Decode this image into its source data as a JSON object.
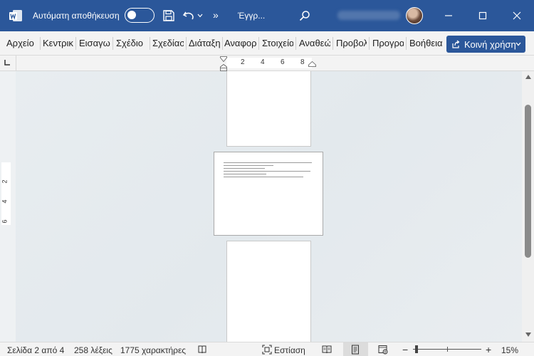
{
  "titlebar": {
    "autosave_label": "Αυτόματη αποθήκευση",
    "more_label": "»",
    "doc_name": "Έγγρ...",
    "accent": "#2b579a"
  },
  "ribbon": {
    "tabs": [
      "Αρχείο",
      "Κεντρικ",
      "Εισαγω",
      "Σχέδιο",
      "Σχεδίασ",
      "Διάταξη",
      "Αναφορ",
      "Στοιχεία",
      "Αναθεώ",
      "Προβολ",
      "Προγρα",
      "Βοήθεια"
    ],
    "share_label": "Κοινή χρήση"
  },
  "ruler": {
    "h_numbers": [
      "2",
      "4",
      "6",
      "8"
    ],
    "v_numbers": [
      "2",
      "4",
      "6"
    ]
  },
  "status": {
    "page": "Σελίδα 2 από 4",
    "words": "258 λέξεις",
    "chars": "1775 χαρακτήρες",
    "focus": "Εστίαση",
    "zoom_minus": "−",
    "zoom_plus": "+",
    "zoom": "15%",
    "zoom_fraction": 0.03
  }
}
